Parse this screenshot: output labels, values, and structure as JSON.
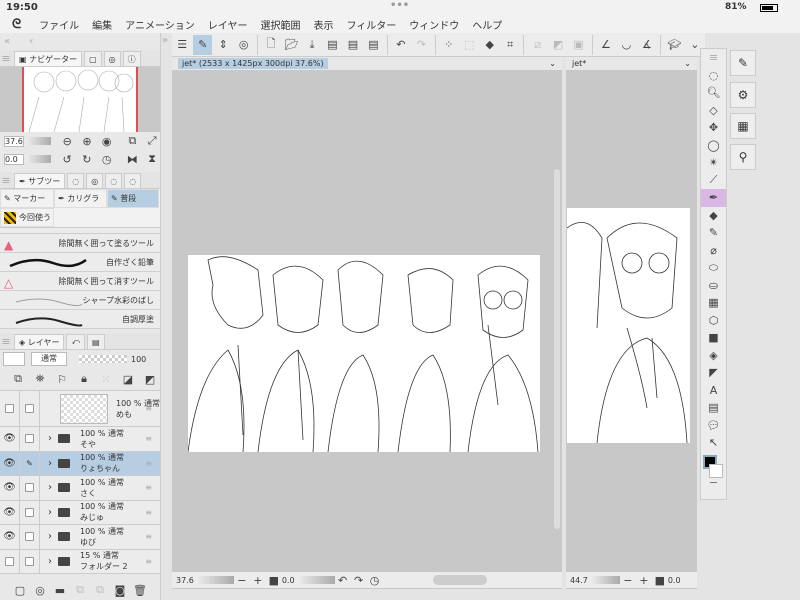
{
  "status": {
    "time": "19:50",
    "battery": "81%"
  },
  "menu": [
    "ファイル",
    "編集",
    "アニメーション",
    "レイヤー",
    "選択範囲",
    "表示",
    "フィルター",
    "ウィンドウ",
    "ヘルプ"
  ],
  "navigator": {
    "tab": "ナビゲーター",
    "zoom": "37.6",
    "rotation": "0.0"
  },
  "subtool": {
    "tab": "サブツー",
    "groups": [
      "マーカー",
      "カリグラ",
      "普段",
      "今回使う"
    ],
    "items": [
      "除間無く囲って塗るツール",
      "自作ざく鉛筆",
      "除間無く囲って消すツール",
      "シャープ水彩のばし",
      "自調厚塗"
    ]
  },
  "layers": {
    "tab": "レイヤー",
    "blend": "通常",
    "opacity": "100",
    "rows": [
      {
        "pct": "100 %",
        "mode": "通常",
        "name": "めも",
        "visible": false,
        "type": "raster"
      },
      {
        "pct": "100 %",
        "mode": "通常",
        "name": "そや",
        "visible": true,
        "type": "folder"
      },
      {
        "pct": "100 %",
        "mode": "通常",
        "name": "りょちゃん",
        "visible": true,
        "type": "folder",
        "selected": true
      },
      {
        "pct": "100 %",
        "mode": "通常",
        "name": "さく",
        "visible": true,
        "type": "folder"
      },
      {
        "pct": "100 %",
        "mode": "通常",
        "name": "みじゅ",
        "visible": true,
        "type": "folder"
      },
      {
        "pct": "100 %",
        "mode": "通常",
        "name": "ゆび",
        "visible": true,
        "type": "folder"
      },
      {
        "pct": "15 %",
        "mode": "通常",
        "name": "フォルダー 2",
        "visible": false,
        "type": "folder"
      }
    ]
  },
  "canvas1": {
    "tab": "jet* (2533 x 1425px 300dpi 37.6%)",
    "zoom": "37.6",
    "rotation": "0.0"
  },
  "canvas2": {
    "tab": "jet*",
    "zoom": "44.7",
    "rotation": "0.0"
  },
  "colors": {
    "selected": "#b6cde2",
    "canvas_bg": "#c8c8c8"
  }
}
